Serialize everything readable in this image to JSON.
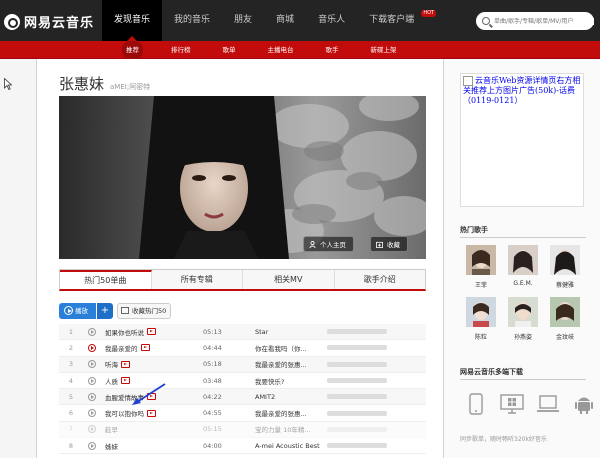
{
  "logo": {
    "text": "网易云音乐"
  },
  "nav": [
    {
      "label": "发现音乐",
      "active": true
    },
    {
      "label": "我的音乐"
    },
    {
      "label": "朋友"
    },
    {
      "label": "商城"
    },
    {
      "label": "音乐人"
    },
    {
      "label": "下载客户端",
      "badge": "HOT"
    }
  ],
  "search": {
    "placeholder": "单曲/歌手/专辑/歌单/MV/用户"
  },
  "subnav": [
    "推荐",
    "排行榜",
    "歌单",
    "主播电台",
    "歌手",
    "新碟上架"
  ],
  "artist": {
    "name": "张惠妹",
    "alias": "aMEI;阿密特",
    "home_button": "个人主页",
    "fav_button": "收藏"
  },
  "tabs": [
    "热门50单曲",
    "所有专辑",
    "相关MV",
    "歌手介绍"
  ],
  "actions": {
    "play": "播放",
    "add": "+",
    "collect": "收藏热门50"
  },
  "songs": [
    {
      "idx": "1",
      "name": "如果你也听说",
      "time": "05:13",
      "album": "Star"
    },
    {
      "idx": "2",
      "name": "我最亲爱的",
      "time": "04:44",
      "album": "你在看我吗（你..."
    },
    {
      "idx": "3",
      "name": "听海",
      "time": "05:18",
      "album": "我最亲爱的张惠..."
    },
    {
      "idx": "4",
      "name": "人质",
      "time": "03:48",
      "album": "我要快乐?"
    },
    {
      "idx": "5",
      "name": "血腥爱情故事",
      "time": "04:22",
      "album": "AMIT2"
    },
    {
      "idx": "6",
      "name": "我可以抱你吗",
      "time": "04:55",
      "album": "我最亲爱的张惠..."
    },
    {
      "idx": "7",
      "name": "趁早",
      "time": "05:15",
      "album": "宝的力量 10年精..."
    },
    {
      "idx": "8",
      "name": "姊妹",
      "time": "04:00",
      "album": "A-mei Acoustic Best"
    }
  ],
  "side": {
    "ad_text": "云音乐Web资源详情页右方相关推荐上方图片广告(50k)-话费（0119-0121）",
    "hot_singers_title": "热门歌手",
    "singers": [
      "王菲",
      "G.E.M.",
      "蔡健雅",
      "陈粒",
      "孙燕姿",
      "金玟岐"
    ],
    "download_title": "网易云音乐多端下载",
    "download_note": "同步歌单，随时畅听320k好音乐"
  },
  "colors": {
    "brand_red": "#c20c0c",
    "header_dark": "#242424",
    "play_blue": "#2a7fd9"
  }
}
